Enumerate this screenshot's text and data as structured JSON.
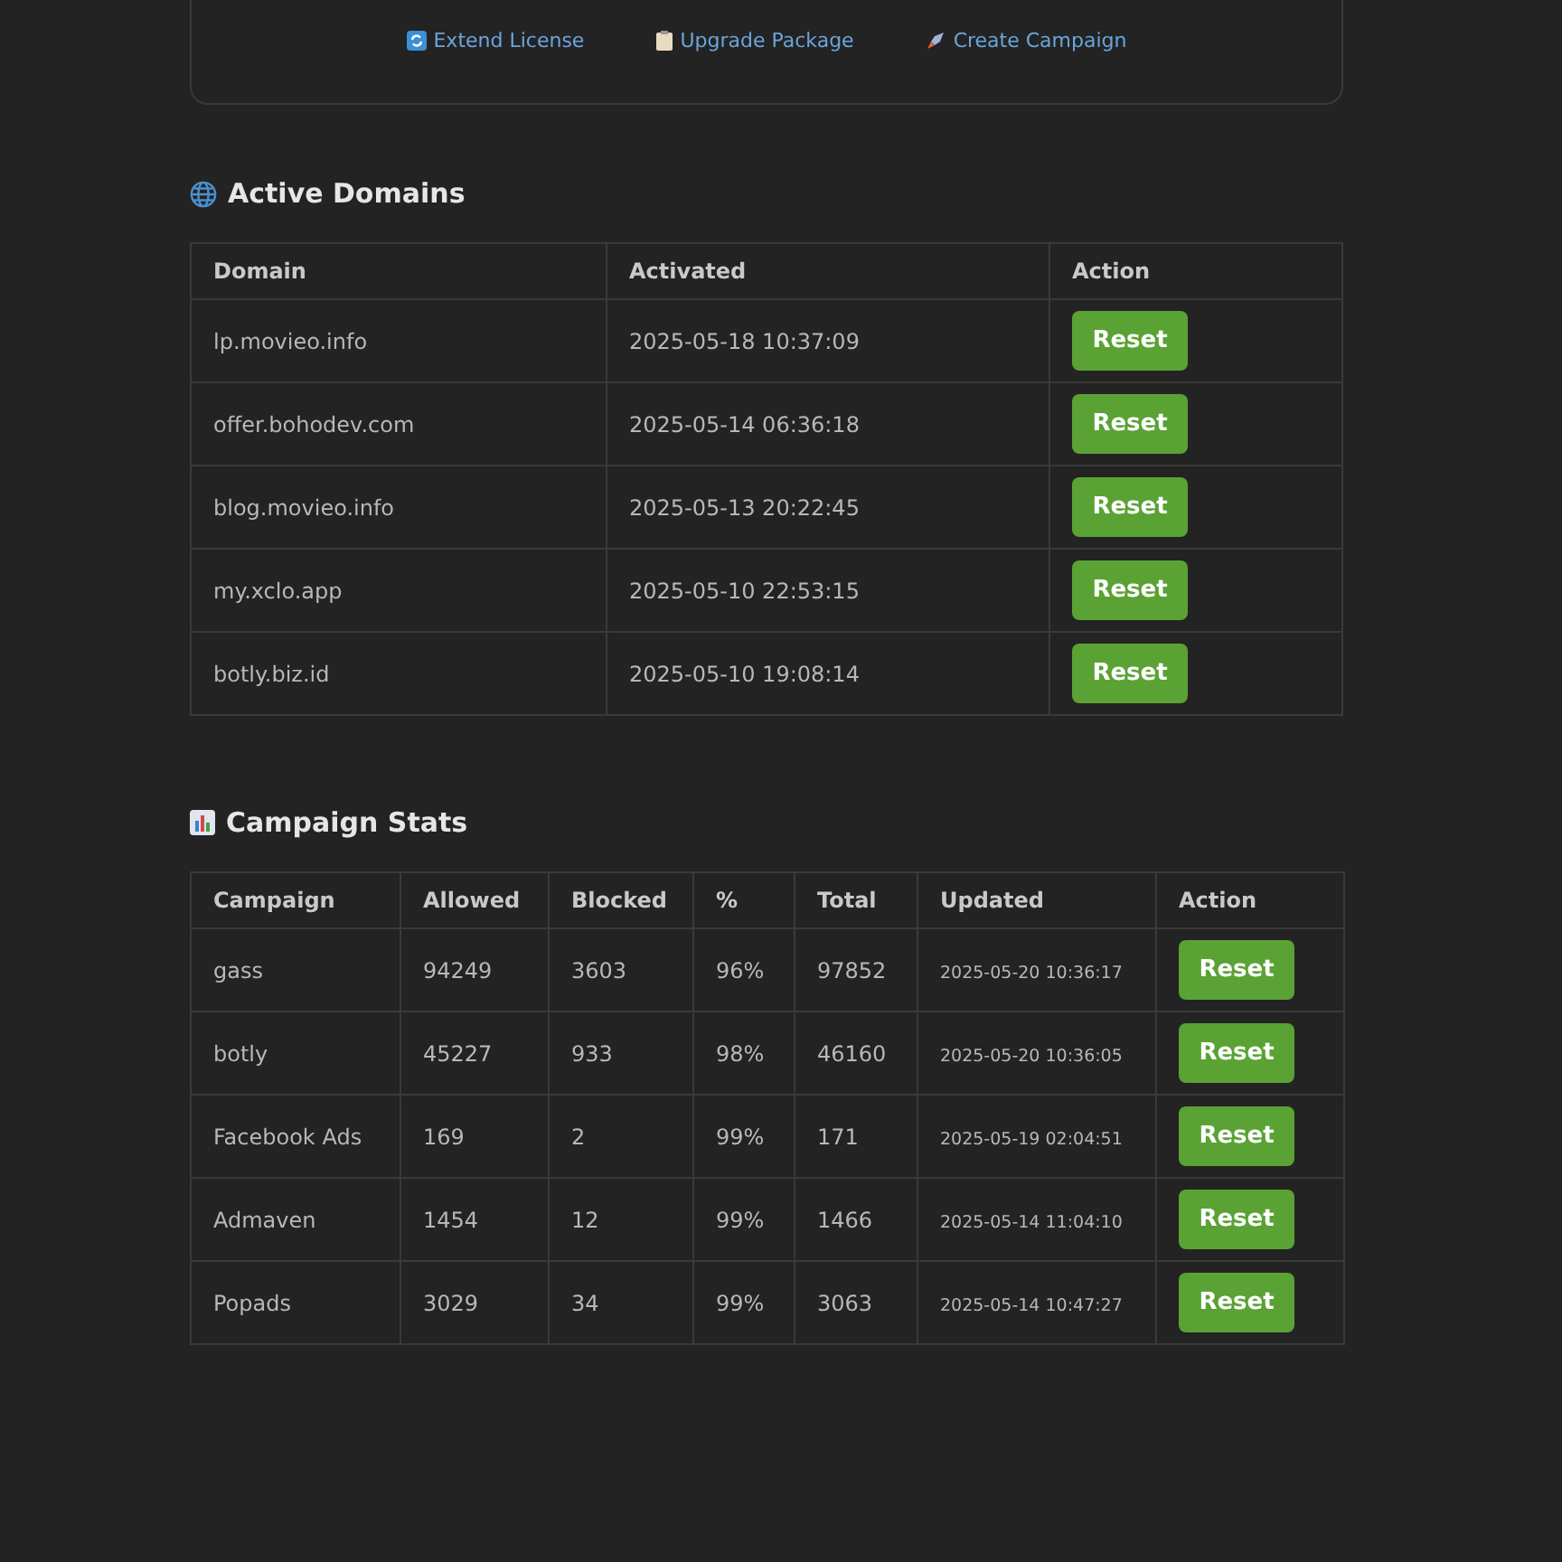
{
  "quick_links": [
    {
      "kind": "extend",
      "label": "Extend License"
    },
    {
      "kind": "upgrade",
      "label": "Upgrade Package"
    },
    {
      "kind": "create",
      "label": "Create Campaign"
    }
  ],
  "domains": {
    "title": "Active Domains",
    "columns": [
      "Domain",
      "Activated",
      "Action"
    ],
    "rows": [
      {
        "domain": "lp.movieo.info",
        "activated": "2025-05-18 10:37:09",
        "action": "Reset"
      },
      {
        "domain": "offer.bohodev.com",
        "activated": "2025-05-14 06:36:18",
        "action": "Reset"
      },
      {
        "domain": "blog.movieo.info",
        "activated": "2025-05-13 20:22:45",
        "action": "Reset"
      },
      {
        "domain": "my.xclo.app",
        "activated": "2025-05-10 22:53:15",
        "action": "Reset"
      },
      {
        "domain": "botly.biz.id",
        "activated": "2025-05-10 19:08:14",
        "action": "Reset"
      }
    ]
  },
  "campaigns": {
    "title": "Campaign Stats",
    "columns": [
      "Campaign",
      "Allowed",
      "Blocked",
      "%",
      "Total",
      "Updated",
      "Action"
    ],
    "rows": [
      {
        "cells": [
          "gass",
          "94249",
          "3603",
          "96%",
          "97852",
          "2025-05-20 10:36:17"
        ],
        "action": "Reset"
      },
      {
        "cells": [
          "botly",
          "45227",
          "933",
          "98%",
          "46160",
          "2025-05-20 10:36:05"
        ],
        "action": "Reset"
      },
      {
        "cells": [
          "Facebook Ads",
          "169",
          "2",
          "99%",
          "171",
          "2025-05-19 02:04:51"
        ],
        "action": "Reset"
      },
      {
        "cells": [
          "Admaven",
          "1454",
          "12",
          "99%",
          "1466",
          "2025-05-14 11:04:10"
        ],
        "action": "Reset"
      },
      {
        "cells": [
          "Popads",
          "3029",
          "34",
          "99%",
          "3063",
          "2025-05-14 10:47:27"
        ],
        "action": "Reset"
      }
    ]
  }
}
